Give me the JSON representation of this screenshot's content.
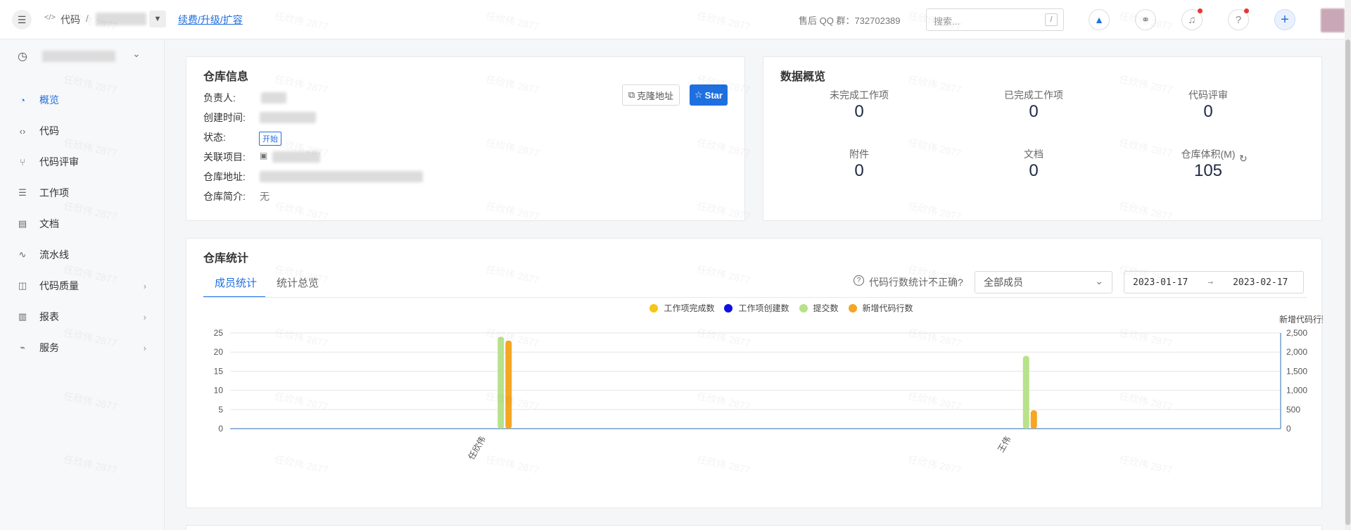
{
  "topbar": {
    "breadcrumb_root": "代码",
    "breadcrumb_sep": "/",
    "renew_link": "续费/升级/扩容",
    "qq_group": "售后 QQ 群：732702389",
    "search_placeholder": "搜索...",
    "search_shortcut": "/"
  },
  "sidebar": {
    "items": [
      {
        "label": "概览",
        "icon": "dashboard-icon",
        "active": true,
        "has_children": false
      },
      {
        "label": "代码",
        "icon": "code-icon",
        "active": false,
        "has_children": false
      },
      {
        "label": "代码评审",
        "icon": "merge-request-icon",
        "active": false,
        "has_children": false
      },
      {
        "label": "工作项",
        "icon": "work-item-icon",
        "active": false,
        "has_children": false
      },
      {
        "label": "文档",
        "icon": "doc-icon",
        "active": false,
        "has_children": false
      },
      {
        "label": "流水线",
        "icon": "pipeline-icon",
        "active": false,
        "has_children": false
      },
      {
        "label": "代码质量",
        "icon": "quality-icon",
        "active": false,
        "has_children": true
      },
      {
        "label": "报表",
        "icon": "report-icon",
        "active": false,
        "has_children": true
      },
      {
        "label": "服务",
        "icon": "service-icon",
        "active": false,
        "has_children": true
      }
    ]
  },
  "repo_info": {
    "title": "仓库信息",
    "owner_label": "负责人:",
    "created_label": "创建时间:",
    "status_label": "状态:",
    "status_value": "开始",
    "project_label": "关联项目:",
    "address_label": "仓库地址:",
    "desc_label": "仓库简介:",
    "desc_value": "无",
    "clone_button": "克隆地址",
    "star_button": "Star"
  },
  "overview": {
    "title": "数据概览",
    "stats": [
      {
        "label": "未完成工作项",
        "value": "0"
      },
      {
        "label": "已完成工作项",
        "value": "0"
      },
      {
        "label": "代码评审",
        "value": "0"
      },
      {
        "label": "附件",
        "value": "0"
      },
      {
        "label": "文档",
        "value": "0"
      },
      {
        "label": "仓库体积(M)",
        "value": "105"
      }
    ]
  },
  "repo_stats": {
    "title": "仓库统计",
    "tabs": [
      "成员统计",
      "统计总览"
    ],
    "hint": "代码行数统计不正确?",
    "member_select": "全部成员",
    "date_start": "2023-01-17",
    "date_arrow": "→",
    "date_end": "2023-02-17"
  },
  "colors": {
    "accent": "#1e6fe0",
    "work_done": "#f5c518",
    "work_created": "#1010e0",
    "commits": "#b7e28a",
    "new_lines": "#f5a623"
  },
  "chart_data": {
    "type": "bar",
    "categories": [
      "任欣伟",
      "王伟"
    ],
    "series": [
      {
        "name": "工作项完成数",
        "axis": "left",
        "values": [
          0,
          0
        ]
      },
      {
        "name": "工作项创建数",
        "axis": "left",
        "values": [
          0,
          0
        ]
      },
      {
        "name": "提交数",
        "axis": "left",
        "values": [
          24,
          19
        ]
      },
      {
        "name": "新增代码行数",
        "axis": "right",
        "values": [
          2300,
          480
        ]
      }
    ],
    "ylim_left": [
      0,
      25
    ],
    "yticks_left": [
      "0",
      "5",
      "10",
      "15",
      "20",
      "25"
    ],
    "ylim_right": [
      0,
      2500
    ],
    "yticks_right": [
      "0",
      "500",
      "1,000",
      "1,500",
      "2,000",
      "2,500"
    ],
    "ylabel_right": "新增代码行数",
    "legend_position": "top-center",
    "grid": true
  }
}
